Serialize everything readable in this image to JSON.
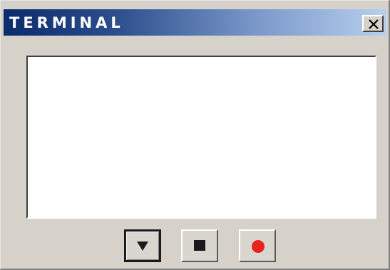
{
  "window": {
    "title": "TERMINAL"
  },
  "controls": {
    "close_icon": "close-x-icon",
    "down_icon": "triangle-down-icon",
    "stop_icon": "stop-square-icon",
    "record_icon": "record-dot-icon"
  },
  "colors": {
    "title_gradient_start": "#0a2b6c",
    "title_gradient_end": "#b8d0ee",
    "window_bg": "#d6d2ca",
    "record_red": "#e8231c",
    "glyph_dark": "#1a1a1a"
  }
}
